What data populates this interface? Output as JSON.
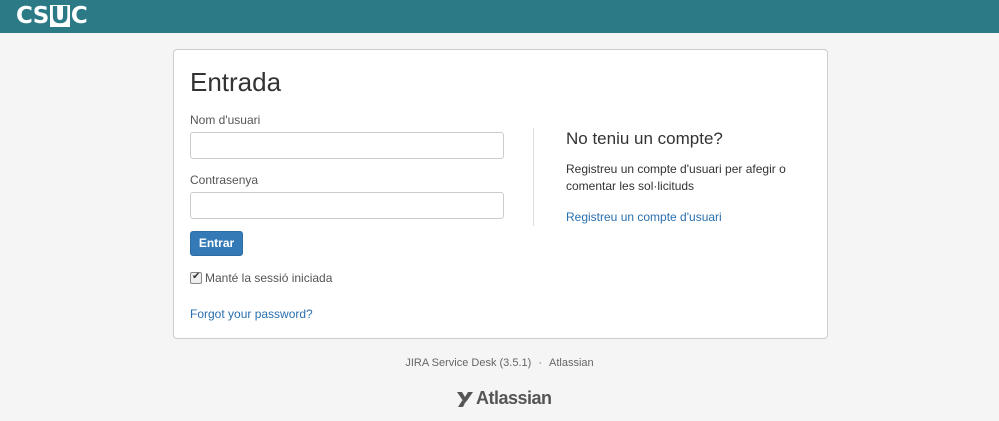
{
  "header": {
    "logo": {
      "pre": "CS",
      "boxed": "U",
      "post": "C"
    }
  },
  "login": {
    "title": "Entrada",
    "username_label": "Nom d'usuari",
    "username_value": "",
    "password_label": "Contrasenya",
    "password_value": "",
    "submit_label": "Entrar",
    "remember_label": "Manté la sessió iniciada",
    "remember_checked": true,
    "forgot_label": "Forgot your password?"
  },
  "signup": {
    "title": "No teniu un compte?",
    "text": "Registreu un compte d'usuari per afegir o comentar les sol·licituds",
    "link_label": "Registreu un compte d'usuari"
  },
  "footer": {
    "product": "JIRA Service Desk (3.5.1)",
    "separator": "·",
    "vendor": "Atlassian",
    "logo_text": "Atlassian"
  },
  "colors": {
    "header_bg": "#2b7a86",
    "button_bg": "#337ab7",
    "link": "#2a6fae"
  }
}
